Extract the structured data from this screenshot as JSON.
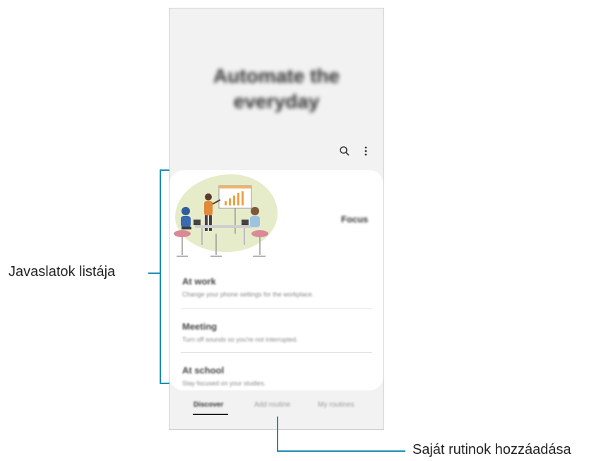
{
  "hero": {
    "title_line1": "Automate the",
    "title_line2": "everyday"
  },
  "toolbar": {
    "search_icon": "search-icon",
    "more_icon": "more-options-icon"
  },
  "featured": {
    "label": "Focus"
  },
  "suggestions": [
    {
      "title": "At work",
      "desc": "Change your phone settings for the workplace."
    },
    {
      "title": "Meeting",
      "desc": "Turn off sounds so you're not interrupted."
    },
    {
      "title": "At school",
      "desc": "Stay focused on your studies."
    }
  ],
  "tabs": [
    "Discover",
    "Add routine",
    "My routines"
  ],
  "callouts": {
    "left": "Javaslatok listája",
    "bottom": "Saját rutinok hozzáadása"
  },
  "colors": {
    "accent": "#1a8fb8",
    "card": "#ffffff",
    "screen_bg": "#f2f2f2"
  }
}
